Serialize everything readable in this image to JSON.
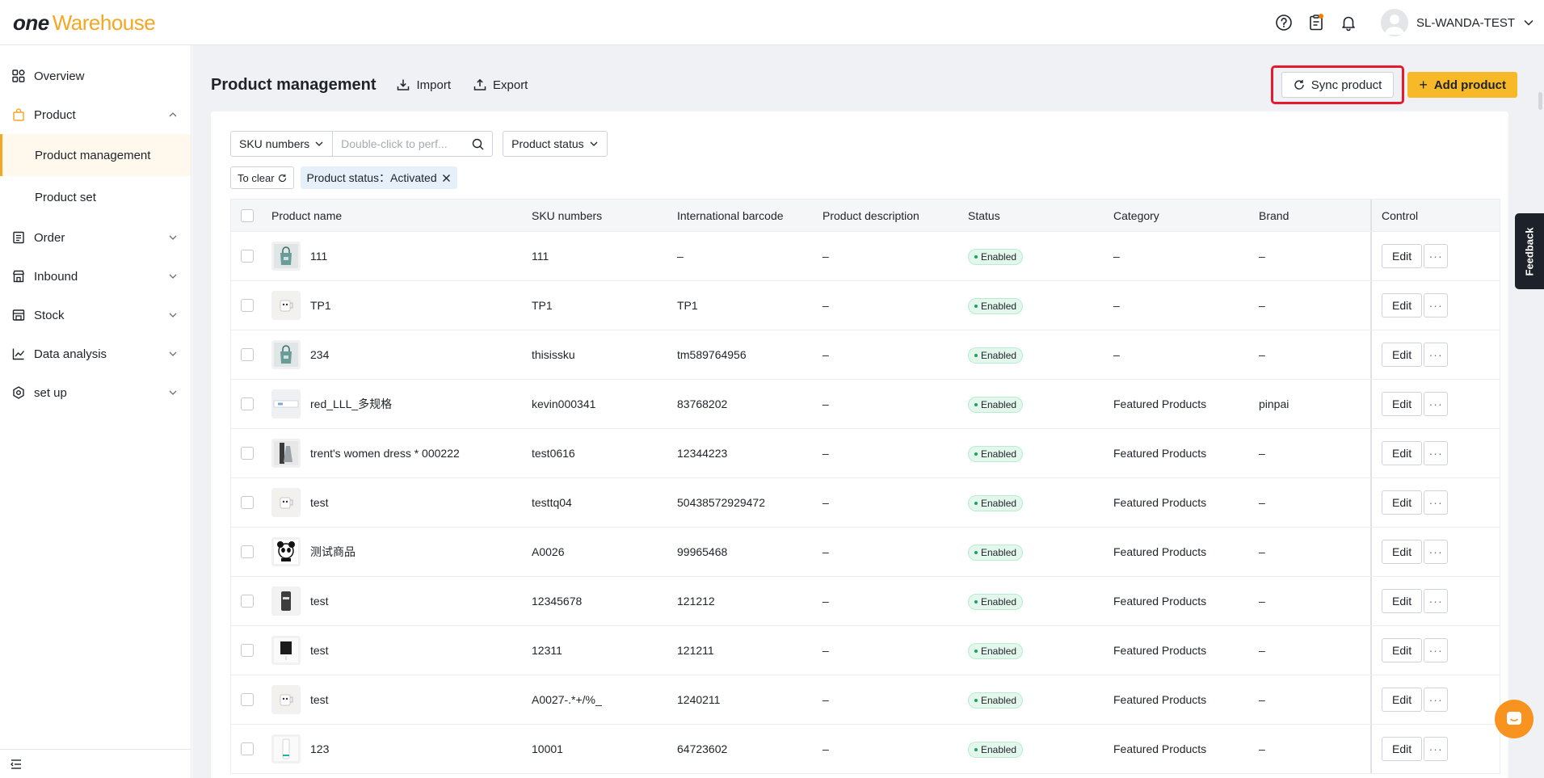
{
  "brand": {
    "logo_one": "ONE",
    "logo_rest": "Warehouse"
  },
  "user": {
    "name": "SL-WANDA-TEST"
  },
  "sidebar": {
    "items": [
      {
        "label": "Overview"
      },
      {
        "label": "Product"
      },
      {
        "label": "Order"
      },
      {
        "label": "Inbound"
      },
      {
        "label": "Stock"
      },
      {
        "label": "Data analysis"
      },
      {
        "label": "set up"
      }
    ],
    "sub_items": [
      {
        "label": "Product management"
      },
      {
        "label": "Product set"
      }
    ]
  },
  "page": {
    "title": "Product management",
    "import_label": "Import",
    "export_label": "Export",
    "sync_label": "Sync product",
    "add_label": "Add product"
  },
  "filters": {
    "sku_select": "SKU numbers",
    "search_placeholder": "Double-click to perf...",
    "status_select": "Product status",
    "clear_label": "To clear",
    "active_filter": "Product status：Activated"
  },
  "table": {
    "columns": [
      "Product name",
      "SKU numbers",
      "International barcode",
      "Product description",
      "Status",
      "Category",
      "Brand",
      "Control"
    ],
    "edit_label": "Edit",
    "more_label": "···",
    "rows": [
      {
        "name": "111",
        "sku": "111",
        "barcode": "–",
        "desc": "–",
        "status": "Enabled",
        "category": "–",
        "brand": "–",
        "thumb": "bag"
      },
      {
        "name": "TP1",
        "sku": "TP1",
        "barcode": "TP1",
        "desc": "–",
        "status": "Enabled",
        "category": "–",
        "brand": "–",
        "thumb": "cup"
      },
      {
        "name": "234",
        "sku": "thisissku",
        "barcode": "tm589764956",
        "desc": "–",
        "status": "Enabled",
        "category": "–",
        "brand": "–",
        "thumb": "bag"
      },
      {
        "name": "red_LLL_多规格",
        "sku": "kevin000341",
        "barcode": "83768202",
        "desc": "–",
        "status": "Enabled",
        "category": "Featured Products",
        "brand": "pinpai",
        "thumb": "device"
      },
      {
        "name": "trent's women dress * 000222",
        "sku": "test0616",
        "barcode": "12344223",
        "desc": "–",
        "status": "Enabled",
        "category": "Featured Products",
        "brand": "–",
        "thumb": "dress"
      },
      {
        "name": "test",
        "sku": "testtq04",
        "barcode": "50438572929472",
        "desc": "–",
        "status": "Enabled",
        "category": "Featured Products",
        "brand": "–",
        "thumb": "cup"
      },
      {
        "name": "测试商品",
        "sku": "A0026",
        "barcode": "99965468",
        "desc": "–",
        "status": "Enabled",
        "category": "Featured Products",
        "brand": "–",
        "thumb": "panda"
      },
      {
        "name": "test",
        "sku": "12345678",
        "barcode": "121212",
        "desc": "–",
        "status": "Enabled",
        "category": "Featured Products",
        "brand": "–",
        "thumb": "phone"
      },
      {
        "name": "test",
        "sku": "12311",
        "barcode": "121211",
        "desc": "–",
        "status": "Enabled",
        "category": "Featured Products",
        "brand": "–",
        "thumb": "black"
      },
      {
        "name": "test",
        "sku": "A0027-.*+/%_",
        "barcode": "1240211",
        "desc": "–",
        "status": "Enabled",
        "category": "Featured Products",
        "brand": "–",
        "thumb": "cup"
      },
      {
        "name": "123",
        "sku": "10001",
        "barcode": "64723602",
        "desc": "–",
        "status": "Enabled",
        "category": "Featured Products",
        "brand": "–",
        "thumb": "bottle"
      }
    ]
  },
  "feedback_label": "Feedback",
  "colors": {
    "accent": "#f7b928",
    "highlight": "#e8192c",
    "enabled_bg": "#e3f7ec"
  }
}
